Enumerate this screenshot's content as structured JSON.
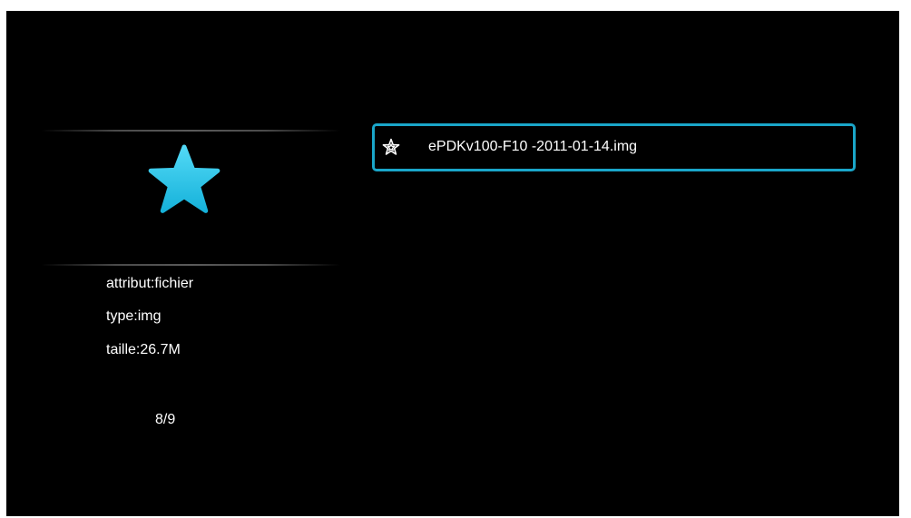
{
  "sidebar": {
    "preview_icon": "star-icon",
    "info": {
      "attribute": "attribut:fichier",
      "type": "type:img",
      "size": "taille:26.7M"
    },
    "page_counter": "8/9"
  },
  "file_list": {
    "items": [
      {
        "icon": "star-outline-icon",
        "label": "ePDKv100-F10 -2011-01-14.img",
        "selected": true
      }
    ]
  },
  "colors": {
    "background": "#000000",
    "accent": "#1aa6c9",
    "star_fill_top": "#4fd6f4",
    "star_fill_bottom": "#17b4dc",
    "text": "#ffffff"
  }
}
